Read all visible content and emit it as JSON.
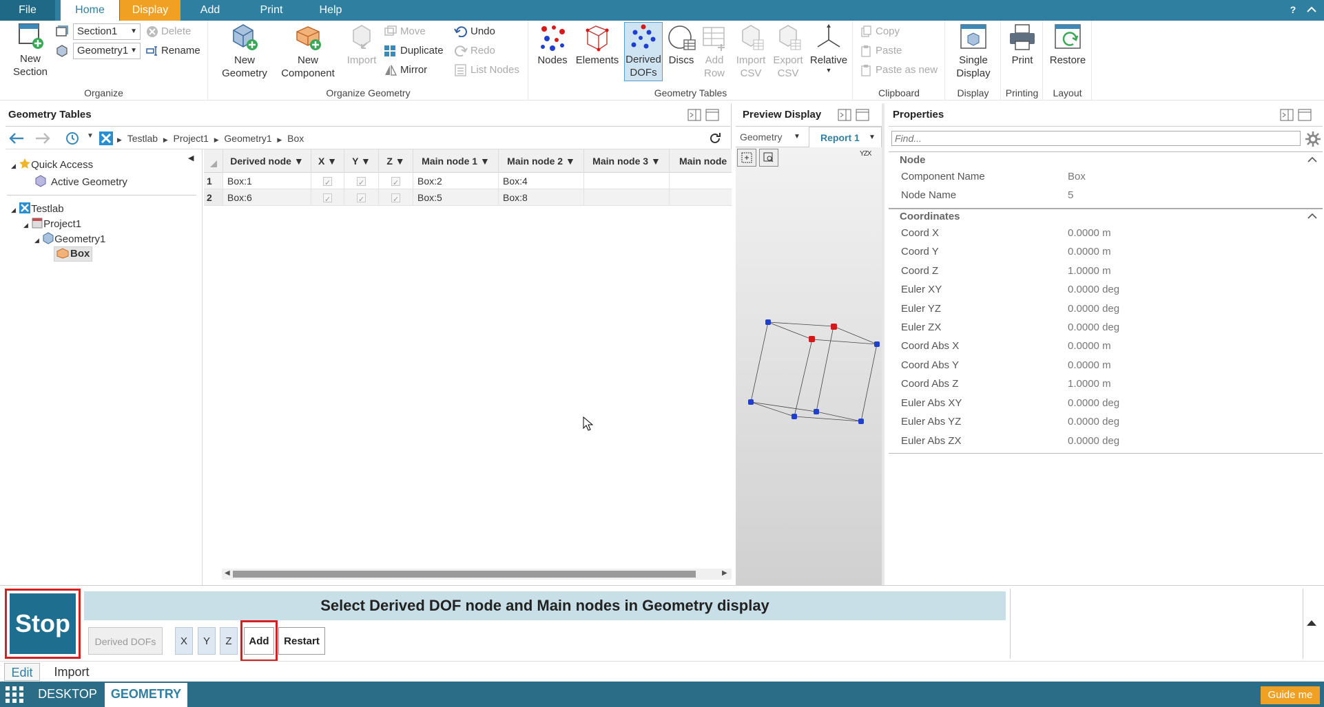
{
  "menu": {
    "file": "File",
    "home": "Home",
    "display": "Display",
    "add": "Add",
    "print": "Print",
    "help": "Help",
    "help_q": "?"
  },
  "ribbon": {
    "organize": {
      "label": "Organize",
      "new_section": "New\nSection",
      "section_combo": "Section1",
      "geometry_combo": "Geometry1",
      "delete": "Delete",
      "rename": "Rename"
    },
    "organize_geometry": {
      "label": "Organize Geometry",
      "new_geometry": "New\nGeometry",
      "new_component": "New\nComponent",
      "import": "Import",
      "move": "Move",
      "duplicate": "Duplicate",
      "mirror": "Mirror",
      "undo": "Undo",
      "redo": "Redo",
      "list_nodes": "List Nodes"
    },
    "geometry_tables": {
      "label": "Geometry Tables",
      "nodes": "Nodes",
      "elements": "Elements",
      "derived_dofs": "Derived\nDOFs",
      "discs": "Discs",
      "add_row": "Add\nRow",
      "import_csv": "Import\nCSV",
      "export_csv": "Export\nCSV",
      "relative": "Relative"
    },
    "clipboard": {
      "label": "Clipboard",
      "copy": "Copy",
      "paste": "Paste",
      "paste_new": "Paste as new"
    },
    "display": {
      "label": "Display",
      "single_display": "Single\nDisplay"
    },
    "printing": {
      "label": "Printing",
      "print": "Print"
    },
    "layout": {
      "label": "Layout",
      "restore": "Restore"
    }
  },
  "left_panel": {
    "title": "Geometry Tables",
    "breadcrumb": [
      "Testlab",
      "Project1",
      "Geometry1",
      "Box"
    ],
    "tree": {
      "quick_access": "Quick Access",
      "active_geometry": "Active Geometry",
      "testlab": "Testlab",
      "project": "Project1",
      "geometry": "Geometry1",
      "box": "Box"
    },
    "table": {
      "columns": [
        "Derived node",
        "X",
        "Y",
        "Z",
        "Main node 1",
        "Main node 2",
        "Main node 3",
        "Main node"
      ],
      "rows": [
        {
          "idx": "1",
          "derived": "Box:1",
          "main1": "Box:2",
          "main2": "Box:4",
          "main3": ""
        },
        {
          "idx": "2",
          "derived": "Box:6",
          "main1": "Box:5",
          "main2": "Box:8",
          "main3": ""
        }
      ]
    }
  },
  "preview": {
    "title": "Preview Display",
    "tab_geometry": "Geometry",
    "tab_report": "Report 1",
    "axis": "YZX"
  },
  "properties": {
    "title": "Properties",
    "find_placeholder": "Find...",
    "node_section": "Node",
    "node_rows": [
      {
        "label": "Component Name",
        "value": "Box"
      },
      {
        "label": "Node Name",
        "value": "5"
      }
    ],
    "coord_section": "Coordinates",
    "coord_rows": [
      {
        "label": "Coord X",
        "value": "0.0000",
        "unit": "m"
      },
      {
        "label": "Coord Y",
        "value": "0.0000",
        "unit": "m"
      },
      {
        "label": "Coord Z",
        "value": "1.0000",
        "unit": "m"
      },
      {
        "label": "Euler XY",
        "value": "0.0000",
        "unit": "deg"
      },
      {
        "label": "Euler YZ",
        "value": "0.0000",
        "unit": "deg"
      },
      {
        "label": "Euler ZX",
        "value": "0.0000",
        "unit": "deg"
      },
      {
        "label": "Coord Abs X",
        "value": "0.0000",
        "unit": "m"
      },
      {
        "label": "Coord Abs Y",
        "value": "0.0000",
        "unit": "m"
      },
      {
        "label": "Coord Abs Z",
        "value": "1.0000",
        "unit": "m"
      },
      {
        "label": "Euler Abs XY",
        "value": "0.0000",
        "unit": "deg"
      },
      {
        "label": "Euler Abs YZ",
        "value": "0.0000",
        "unit": "deg"
      },
      {
        "label": "Euler Abs ZX",
        "value": "0.0000",
        "unit": "deg"
      }
    ]
  },
  "bottom": {
    "stop": "Stop",
    "instruction": "Select Derived DOF node and Main nodes in Geometry display",
    "derived_dofs": "Derived DOFs",
    "x": "X",
    "y": "Y",
    "z": "Z",
    "add": "Add",
    "restart": "Restart"
  },
  "tabs": {
    "edit": "Edit",
    "import": "Import"
  },
  "taskbar": {
    "desktop": "DESKTOP",
    "geometry": "GEOMETRY",
    "guide": "Guide me"
  },
  "colors": {
    "accent": "#2f7fa0",
    "display_tab": "#f0a022",
    "node_blue": "#1f3fd0",
    "node_red": "#d81818",
    "stop_bg": "#1d6e8f",
    "guide": "#f0a022"
  }
}
